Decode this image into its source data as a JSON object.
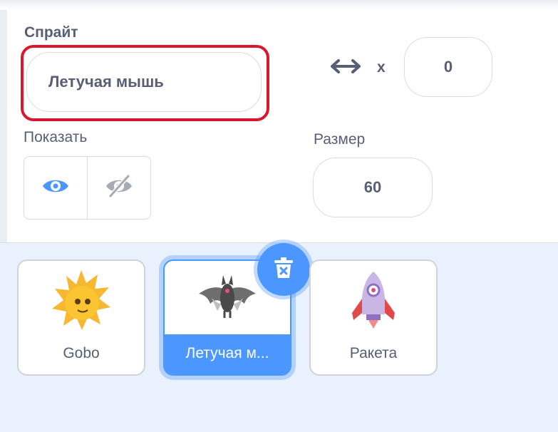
{
  "sprite_info": {
    "sprite_label": "Спрайт",
    "sprite_name": "Летучая мышь",
    "x_label": "x",
    "x_value": "0",
    "show_label": "Показать",
    "size_label": "Размер",
    "size_value": "60"
  },
  "icons": {
    "position": "horizontal-arrows-icon",
    "show": "eye-icon",
    "hide": "eye-slash-icon",
    "delete": "trash-icon"
  },
  "colors": {
    "accent": "#4c97ff",
    "highlight": "#d9182e",
    "text": "#575e75",
    "list_bg": "#e9f1fc"
  },
  "sprites": [
    {
      "name": "Gobo",
      "selected": false
    },
    {
      "name": "Летучая м...",
      "selected": true
    },
    {
      "name": "Ракета",
      "selected": false
    }
  ]
}
